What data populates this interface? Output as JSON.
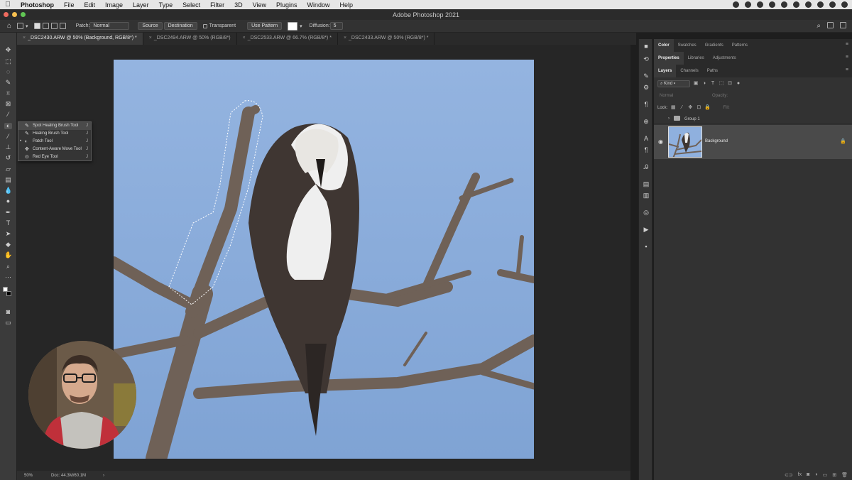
{
  "menubar": {
    "apple": "",
    "items": [
      "Photoshop",
      "File",
      "Edit",
      "Image",
      "Layer",
      "Type",
      "Select",
      "Filter",
      "3D",
      "View",
      "Plugins",
      "Window",
      "Help"
    ]
  },
  "window": {
    "title": "Adobe Photoshop 2021"
  },
  "options": {
    "patch_label": "Patch:",
    "patch_value": "Normal",
    "source": "Source",
    "destination": "Destination",
    "transparent": "Transparent",
    "use_pattern": "Use Pattern",
    "diffusion_label": "Diffusion:",
    "diffusion_value": "5"
  },
  "tabs": [
    "_DSC2430.ARW @ 50% (Background, RGB/8*) *",
    "_DSC2494.ARW @ 50% (RGB/8*)",
    "_DSC2533.ARW @ 66.7% (RGB/8*) *",
    "_DSC2433.ARW @ 50% (RGB/8*) *"
  ],
  "flyout": {
    "items": [
      {
        "label": "Spot Healing Brush Tool",
        "key": "J"
      },
      {
        "label": "Healing Brush Tool",
        "key": "J"
      },
      {
        "label": "Patch Tool",
        "key": "J"
      },
      {
        "label": "Content-Aware Move Tool",
        "key": "J"
      },
      {
        "label": "Red Eye Tool",
        "key": "J"
      }
    ],
    "bullet": "•"
  },
  "status": {
    "zoom": "50%",
    "doc": "Doc: 44.3M/60.1M",
    "arrow": "›"
  },
  "panels": {
    "top_tabs": [
      "Color",
      "Swatches",
      "Gradients",
      "Patterns"
    ],
    "mid_tabs": [
      "Properties",
      "Libraries",
      "Adjustments"
    ],
    "layer_tabs": [
      "Layers",
      "Channels",
      "Paths"
    ],
    "kind": "Kind",
    "blend": "Normal",
    "opacity": "Opacity:",
    "lock": "Lock:",
    "fill": "Fill:",
    "group_name": "Group 1",
    "layer_name": "Background"
  },
  "colors": {
    "sky": "#8fb0de",
    "ui_dark": "#323232",
    "branch": "#7a6a5c"
  }
}
